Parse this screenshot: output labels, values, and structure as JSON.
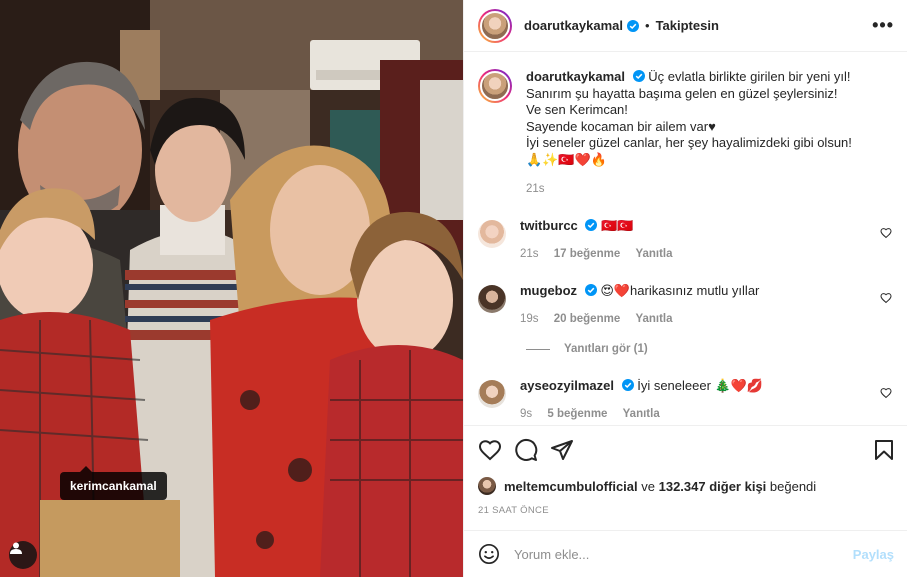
{
  "photo": {
    "tag_label": "kerimcankamal",
    "tag_user_icon": "user-icon"
  },
  "header": {
    "username": "doarutkaykamal",
    "separator": "•",
    "follow_state": "Takiptesin",
    "more_icon": "more-options-icon"
  },
  "caption": {
    "username": "doarutkaykamal",
    "lines": [
      "Üç evlatla birlikte girilen bir yeni yıl!",
      "Sanırım şu hayatta başıma gelen en güzel şeylersiniz!",
      "Ve sen Kerimcan!",
      "Sayende kocaman bir ailem var♥",
      "İyi seneler güzel canlar, her şey hayalimizdeki gibi olsun!",
      "🙏✨🇹🇷❤️🔥"
    ],
    "time": "21s"
  },
  "comments": [
    {
      "username": "twitburcc",
      "text": "🇹🇷🇹🇷",
      "time": "21s",
      "likes": "17 beğenme",
      "reply": "Yanıtla"
    },
    {
      "username": "mugeboz",
      "text": "😍❤️harikasınız mutlu yıllar",
      "time": "19s",
      "likes": "20 beğenme",
      "reply": "Yanıtla"
    },
    {
      "username": "ayseozyilmazel",
      "text": "İyi seneleeer 🎄❤️💋",
      "time": "9s",
      "likes": "5 beğenme",
      "reply": "Yanıtla"
    }
  ],
  "view_replies": "Yanıtları gör (1)",
  "actions": {
    "icons": [
      "heart-icon",
      "comment-icon",
      "share-icon",
      "bookmark-icon"
    ],
    "liked_by_user": "meltemcumbulofficial",
    "liked_by_mid": " ve ",
    "liked_by_count": "132.347 diğer kişi",
    "liked_by_suffix": " beğendi",
    "time_ago": "21 SAAT ÖNCE"
  },
  "add_comment": {
    "placeholder": "Yorum ekle...",
    "post_label": "Paylaş"
  },
  "colors": {
    "verified": "#0095f6",
    "post_disabled": "#b2dffc",
    "muted": "#8e8e8e"
  }
}
